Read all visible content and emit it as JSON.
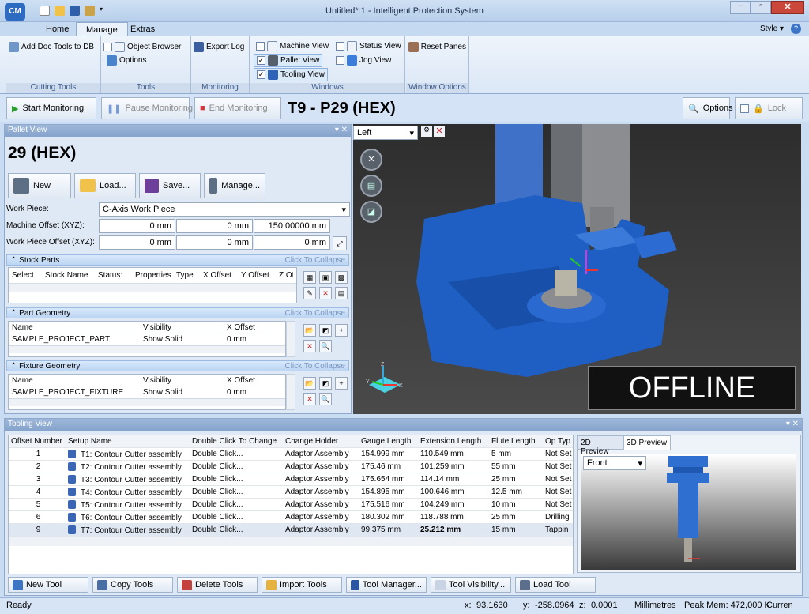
{
  "window": {
    "title": "Untitled*:1 - Intelligent Protection System",
    "logo": "CM"
  },
  "ribbon_tabs": [
    "Home",
    "Manage",
    "Extras"
  ],
  "style_menu": "Style",
  "groups": {
    "cutting_tools": {
      "label": "Cutting Tools",
      "add_doc": "Add Doc Tools to DB"
    },
    "tools": {
      "label": "Tools",
      "object_browser": "Object Browser",
      "options": "Options"
    },
    "monitoring": {
      "label": "Monitoring",
      "export_log": "Export Log"
    },
    "windows": {
      "label": "Windows",
      "machine_view": "Machine View",
      "pallet_view": "Pallet View",
      "tooling_view": "Tooling View",
      "status_view": "Status View",
      "jog_view": "Jog View"
    },
    "window_options": {
      "label": "Window Options",
      "reset_panes": "Reset Panes"
    }
  },
  "toolbar": {
    "start": "Start Monitoring",
    "pause": "Pause Monitoring",
    "end": "End Monitoring",
    "title": "T9 - P29 (HEX)",
    "options": "Options",
    "lock": "Lock"
  },
  "pallet": {
    "panel_title": "Pallet View",
    "heading": "29 (HEX)",
    "buttons": {
      "new": "New",
      "load": "Load...",
      "save": "Save...",
      "manage": "Manage..."
    },
    "work_piece_label": "Work Piece:",
    "work_piece_value": "C-Axis Work Piece",
    "machine_offset_label": "Machine Offset (XYZ):",
    "machine_offset": [
      "0 mm",
      "0 mm",
      "150.00000 mm"
    ],
    "wp_offset_label": "Work Piece Offset (XYZ):",
    "wp_offset": [
      "0 mm",
      "0 mm",
      "0 mm"
    ],
    "collapse": "Click To Collapse",
    "stock": {
      "title": "Stock Parts",
      "cols": [
        "Select",
        "Stock Name",
        "Status:",
        "Properties",
        "Type",
        "X Offset",
        "Y Offset",
        "Z Of"
      ]
    },
    "part": {
      "title": "Part Geometry",
      "cols": [
        "Name",
        "Visibility",
        "X Offset"
      ],
      "row": {
        "name": "SAMPLE_PROJECT_PART",
        "vis": "Show Solid",
        "x": "0 mm"
      }
    },
    "fixture": {
      "title": "Fixture Geometry",
      "cols": [
        "Name",
        "Visibility",
        "X Offset"
      ],
      "row": {
        "name": "SAMPLE_PROJECT_FIXTURE",
        "vis": "Show Solid",
        "x": "0 mm"
      }
    }
  },
  "viewport": {
    "view_select": "Left",
    "status": "OFFLINE"
  },
  "tooling": {
    "panel_title": "Tooling View",
    "cols": [
      "Offset Number",
      "Setup Name",
      "Double Click To Change",
      "Change Holder",
      "Gauge Length",
      "Extension Length",
      "Flute Length",
      "Op Typ"
    ],
    "rows": [
      [
        "1",
        "T1: Contour Cutter assembly",
        "Double Click...",
        "Adaptor Assembly",
        "154.999 mm",
        "110.549 mm",
        "5 mm",
        "Not Set"
      ],
      [
        "2",
        "T2: Contour Cutter assembly",
        "Double Click...",
        "Adaptor Assembly",
        "175.46 mm",
        "101.259 mm",
        "55 mm",
        "Not Set"
      ],
      [
        "3",
        "T3: Contour Cutter assembly",
        "Double Click...",
        "Adaptor Assembly",
        "175.654 mm",
        "114.14 mm",
        "25 mm",
        "Not Set"
      ],
      [
        "4",
        "T4: Contour Cutter assembly",
        "Double Click...",
        "Adaptor Assembly",
        "154.895 mm",
        "100.646 mm",
        "12.5 mm",
        "Not Set"
      ],
      [
        "5",
        "T5: Contour Cutter assembly",
        "Double Click...",
        "Adaptor Assembly",
        "175.516 mm",
        "104.249 mm",
        "10 mm",
        "Not Set"
      ],
      [
        "6",
        "T6: Contour Cutter assembly",
        "Double Click...",
        "Adaptor Assembly",
        "180.302 mm",
        "118.788 mm",
        "25 mm",
        "Drilling"
      ],
      [
        "9",
        "T7: Contour Cutter assembly",
        "Double Click...",
        "Adaptor Assembly",
        "99.375 mm",
        "25.212 mm",
        "15 mm",
        "Tappin"
      ]
    ],
    "preview_tabs": [
      "2D Preview",
      "3D Preview"
    ],
    "preview_view": "Front",
    "bottom_buttons": [
      "New Tool",
      "Copy Tools",
      "Delete Tools",
      "Import Tools",
      "Tool Manager...",
      "Tool Visibility...",
      "Load Tool"
    ]
  },
  "status": {
    "ready": "Ready",
    "x_label": "x:",
    "x": "93.1630",
    "y_label": "y:",
    "y": "-258.0964",
    "z_label": "z:",
    "z": "0.0001",
    "units": "Millimetres",
    "peak": "Peak Mem: 472,000 K",
    "current": "Curren"
  }
}
